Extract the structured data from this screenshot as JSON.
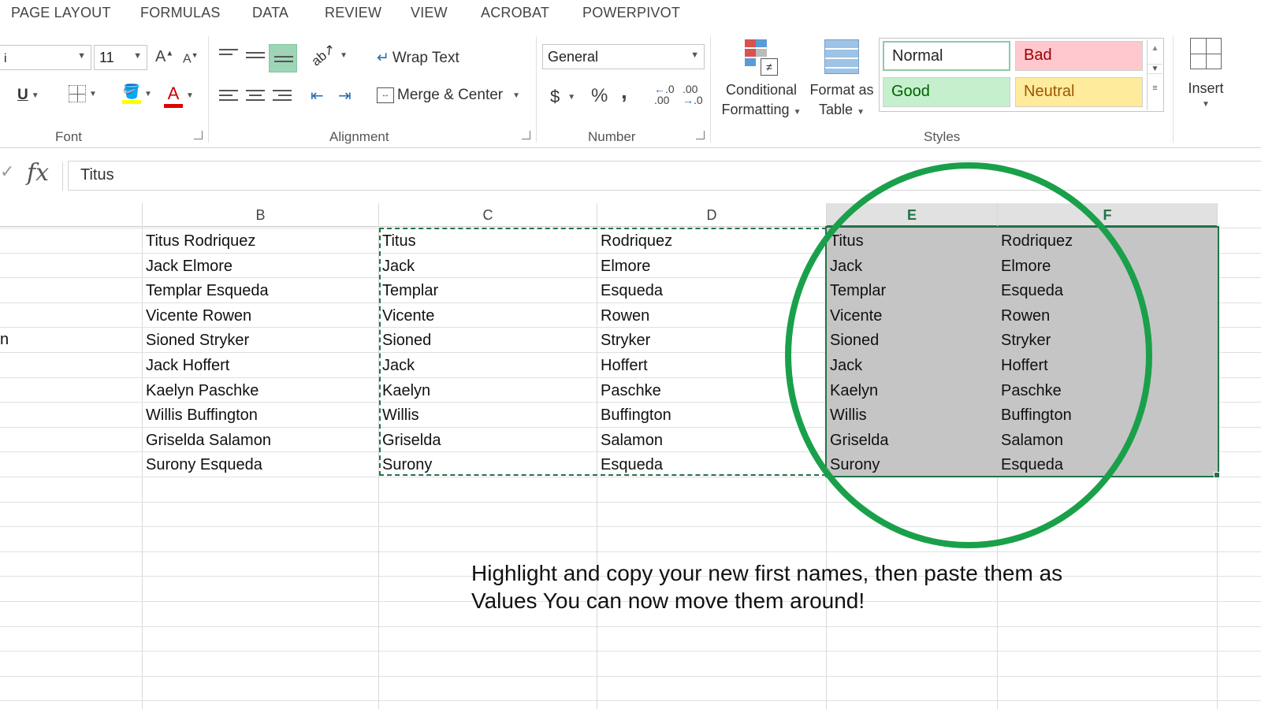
{
  "tabs": [
    "PAGE LAYOUT",
    "FORMULAS",
    "DATA",
    "REVIEW",
    "VIEW",
    "ACROBAT",
    "POWERPIVOT"
  ],
  "font": {
    "size": "11",
    "group_label": "Font",
    "grow_label": "A",
    "shrink_label": "A",
    "underline_label": "U",
    "font_color_label": "A"
  },
  "alignment": {
    "wrap_text": "Wrap Text",
    "merge_center": "Merge & Center",
    "group_label": "Alignment"
  },
  "number": {
    "format": "General",
    "currency": "$",
    "percent": "%",
    "comma": ",",
    "inc_decimal": ".00",
    "dec_decimal": ".00",
    "group_label": "Number"
  },
  "styles": {
    "conditional_formatting": [
      "Conditional",
      "Formatting"
    ],
    "format_as_table": [
      "Format as",
      "Table"
    ],
    "normal": "Normal",
    "bad": "Bad",
    "good": "Good",
    "neutral": "Neutral",
    "group_label": "Styles",
    "colors": {
      "normal_bg": "#ffffff",
      "bad_bg": "#ffc7ce",
      "bad_fg": "#9c0006",
      "good_bg": "#c6efce",
      "good_fg": "#006100",
      "neutral_bg": "#ffeb9c",
      "neutral_fg": "#9c5700"
    }
  },
  "cells": {
    "insert": "Insert"
  },
  "formula_bar": {
    "fx": "fx",
    "value": "Titus"
  },
  "columns": [
    "B",
    "C",
    "D",
    "E",
    "F"
  ],
  "rows": [
    {
      "b": "Titus Rodriquez",
      "c": "Titus",
      "d": "Rodriquez",
      "e": "Titus",
      "f": "Rodriquez"
    },
    {
      "b": "Jack Elmore",
      "c": "Jack",
      "d": "Elmore",
      "e": "Jack",
      "f": "Elmore"
    },
    {
      "b": "Templar Esqueda",
      "c": "Templar",
      "d": "Esqueda",
      "e": "Templar",
      "f": "Esqueda"
    },
    {
      "b": "Vicente Rowen",
      "c": "Vicente",
      "d": "Rowen",
      "e": "Vicente",
      "f": "Rowen"
    },
    {
      "b": "Sioned Stryker",
      "c": "Sioned",
      "d": "Stryker",
      "e": "Sioned",
      "f": "Stryker"
    },
    {
      "b": "Jack Hoffert",
      "c": "Jack",
      "d": "Hoffert",
      "e": "Jack",
      "f": "Hoffert"
    },
    {
      "b": "Kaelyn Paschke",
      "c": "Kaelyn",
      "d": "Paschke",
      "e": "Kaelyn",
      "f": "Paschke"
    },
    {
      "b": "Willis Buffington",
      "c": "Willis",
      "d": "Buffington",
      "e": "Willis",
      "f": "Buffington"
    },
    {
      "b": "Griselda Salamon",
      "c": "Griselda",
      "d": "Salamon",
      "e": "Griselda",
      "f": "Salamon"
    },
    {
      "b": "Surony Esqueda",
      "c": "Surony",
      "d": "Esqueda",
      "e": "Surony",
      "f": "Esqueda"
    }
  ],
  "row_fragment": "n",
  "annotation": {
    "line1": "Highlight and copy your new first names, then paste them as",
    "line2": "Values You can now move them around!",
    "accent": "#1aa04a"
  }
}
